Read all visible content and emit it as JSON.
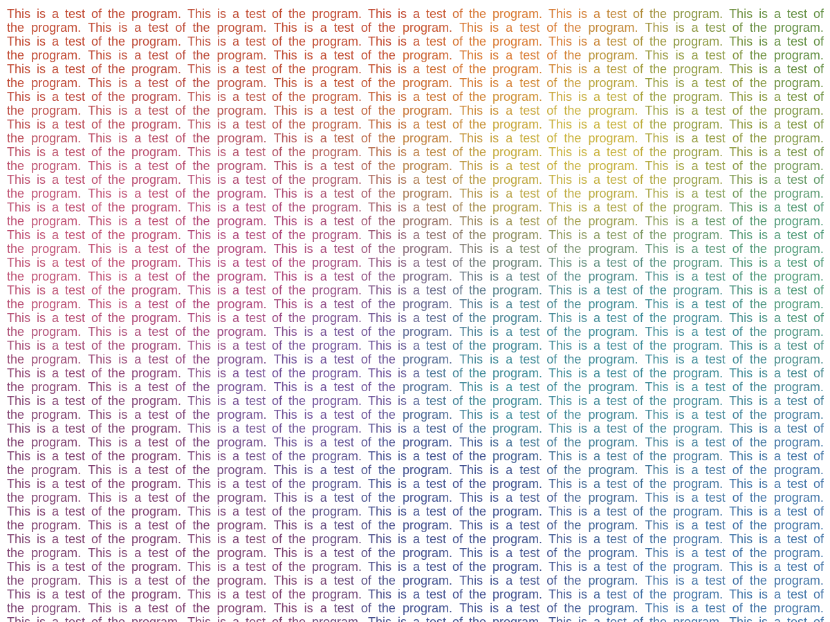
{
  "document": {
    "sentence": "This is a test of the program. ",
    "lines": [
      "This is a test of the program. This is a test of the program. This is a test of the program. This is a test of the program. This is a test of",
      "the program. This is a test of the program. This is a test of the program. This is a test of the program. This is a test of the program.",
      "This is a test of the program. This is a test of the program. This is a test of the program. This is a test of the program. This is a test of",
      "the program. This is a test of the program. This is a test of the program. This is a test of the program. This is a test of the program.",
      "This is a test of the program. This is a test of the program. This is a test of the program. This is a test of the program. This is a test of",
      "the program. This is a test of the program. This is a test of the program. This is a test of the program. This is a test of the program.",
      "This is a test of the program. This is a test of the program. This is a test of the program. This is a test of the program. This is a test of",
      "the program. This is a test of the program. This is a test of the program. This is a test of the program. This is a test of the program.",
      "This is a test of the program. This is a test of the program. This is a test of the program. This is a test of the program. This is a test of",
      "the program. This is a test of the program. This is a test of the program. This is a test of the program. This is a test of the program.",
      "This is a test of the program. This is a test of the program. This is a test of the program. This is a test of the program. This is a test of",
      "the program. This is a test of the program. This is a test of the program. This is a test of the program. This is a test of the program.",
      "This is a test of the program. This is a test of the program. This is a test of the program. This is a test of the program. This is a test of",
      "the program. This is a test of the program. This is a test of the program. This is a test of the program. This is a test of the program.",
      "This is a test of the program. This is a test of the program. This is a test of the program. This is a test of the program. This is a test of",
      "the program. This is a test of the program. This is a test of the program. This is a test of the program. This is a test of the program.",
      "This is a test of the program. This is a test of the program. This is a test of the program. This is a test of the program. This is a test of",
      "the program. This is a test of the program. This is a test of the program. This is a test of the program. This is a test of the program.",
      "This is a test of the program. This is a test of the program. This is a test of the program. This is a test of the program. This is a test of",
      "the program. This is a test of the program. This is a test of the program. This is a test of the program. This is a test of the program.",
      "This is a test of the program. This is a test of the program. This is a test of the program. This is a test of the program. This is a test of",
      "the program. This is a test of the program. This is a test of the program. This is a test of the program. This is a test of the program.",
      "This is a test of the program. This is a test of the program. This is a test of the program. This is a test of the program. This is a test of",
      "the program. This is a test of the program. This is a test of the program. This is a test of the program. This is a test of the program.",
      "This is a test of the program. This is a test of the program. This is a test of the program. This is a test of the program. This is a test of",
      "the program. This is a test of the program. This is a test of the program. This is a test of the program. This is a test of the program.",
      "This is a test of the program. This is a test of the program. This is a test of the program. This is a test of the program. This is a test of",
      "the program. This is a test of the program. This is a test of the program. This is a test of the program. This is a test of the program.",
      "This is a test of the program. This is a test of the program. This is a test of the program. This is a test of the program. This is a test of",
      "the program. This is a test of the program. This is a test of the program. This is a test of the program. This is a test of the program.",
      "This is a test of the program. This is a test of the program. This is a test of the program. This is a test of the program. This is a test of",
      "the program. This is a test of the program. This is a test of the program. This is a test of the program. This is a test of the program.",
      "This is a test of the program. This is a test of the program. This is a test of the program. This is a test of the program. This is a test of",
      "the program. This is a test of the program. This is a test of the program. This is a test of the program. This is a test of the program.",
      "This is a test of the program. This is a test of the program. This is a test of the program. This is a test of the program. This is a test of",
      "the program. This is a test of the program. This is a test of the program. This is a test of the program. This is a test of the program.",
      "This is a test of the program. This is a test of the program. This is a test of the program. This is a test of the program. This is a test of",
      "the program. This is a test of the program. This is a test of the program. This is a test of the program. This is a test of the program.",
      "This is a test of the program. This is a test of the program. This is a test of the program. This is a test of the program. This is a test of",
      "the program. This is a test of the program. This is a test of the program. This is a test of the program. This is a test of the program.",
      "This is a test of the program. This is a test of the program. This is a test of the program. This is a test of the program. This is a test of",
      "the program. This is a test of the program. This is a test of the program. This is a test of the program. This is a test of the program.",
      "This is a test of the program. This is a test of the program. This is a test of the program. This is a test of the program. This is a test of",
      "the program. This is a test of the program. This is a test of the program. This is a test of the program. This is a test of the program.",
      "This is a test of the program. This is a test of the program. This is a test of the program. This is a test of the program. This is a test of"
    ]
  },
  "colors": {
    "background": "#ffffff",
    "palette": {
      "red_orange": "#c0452d",
      "orange": "#d9782f",
      "gold": "#c9b23a",
      "olive": "#8f9a3f",
      "green": "#5f8d3f",
      "sea_green": "#4f9a78",
      "teal": "#3f8c99",
      "blue": "#3f72a6",
      "indigo": "#3f4f8f",
      "purple": "#6f4f9a",
      "magenta": "#b0457a",
      "rose": "#c04f72",
      "plum": "#7f3f6f"
    }
  }
}
